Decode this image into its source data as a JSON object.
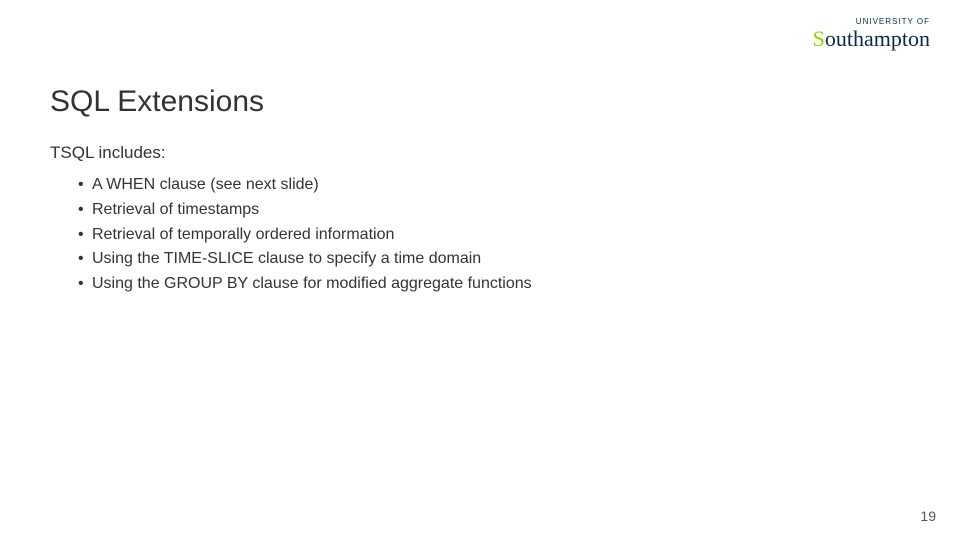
{
  "logo": {
    "superscript": "UNIVERSITY OF",
    "name_prefix": "S",
    "name_rest": "outhampton"
  },
  "slide": {
    "title": "SQL Extensions",
    "intro": "TSQL includes:",
    "bullets": [
      "A WHEN clause (see next slide)",
      "Retrieval of timestamps",
      "Retrieval of temporally ordered information",
      "Using the TIME-SLICE clause to specify a time domain",
      "Using the GROUP BY clause for modified aggregate functions"
    ]
  },
  "page_number": "19"
}
